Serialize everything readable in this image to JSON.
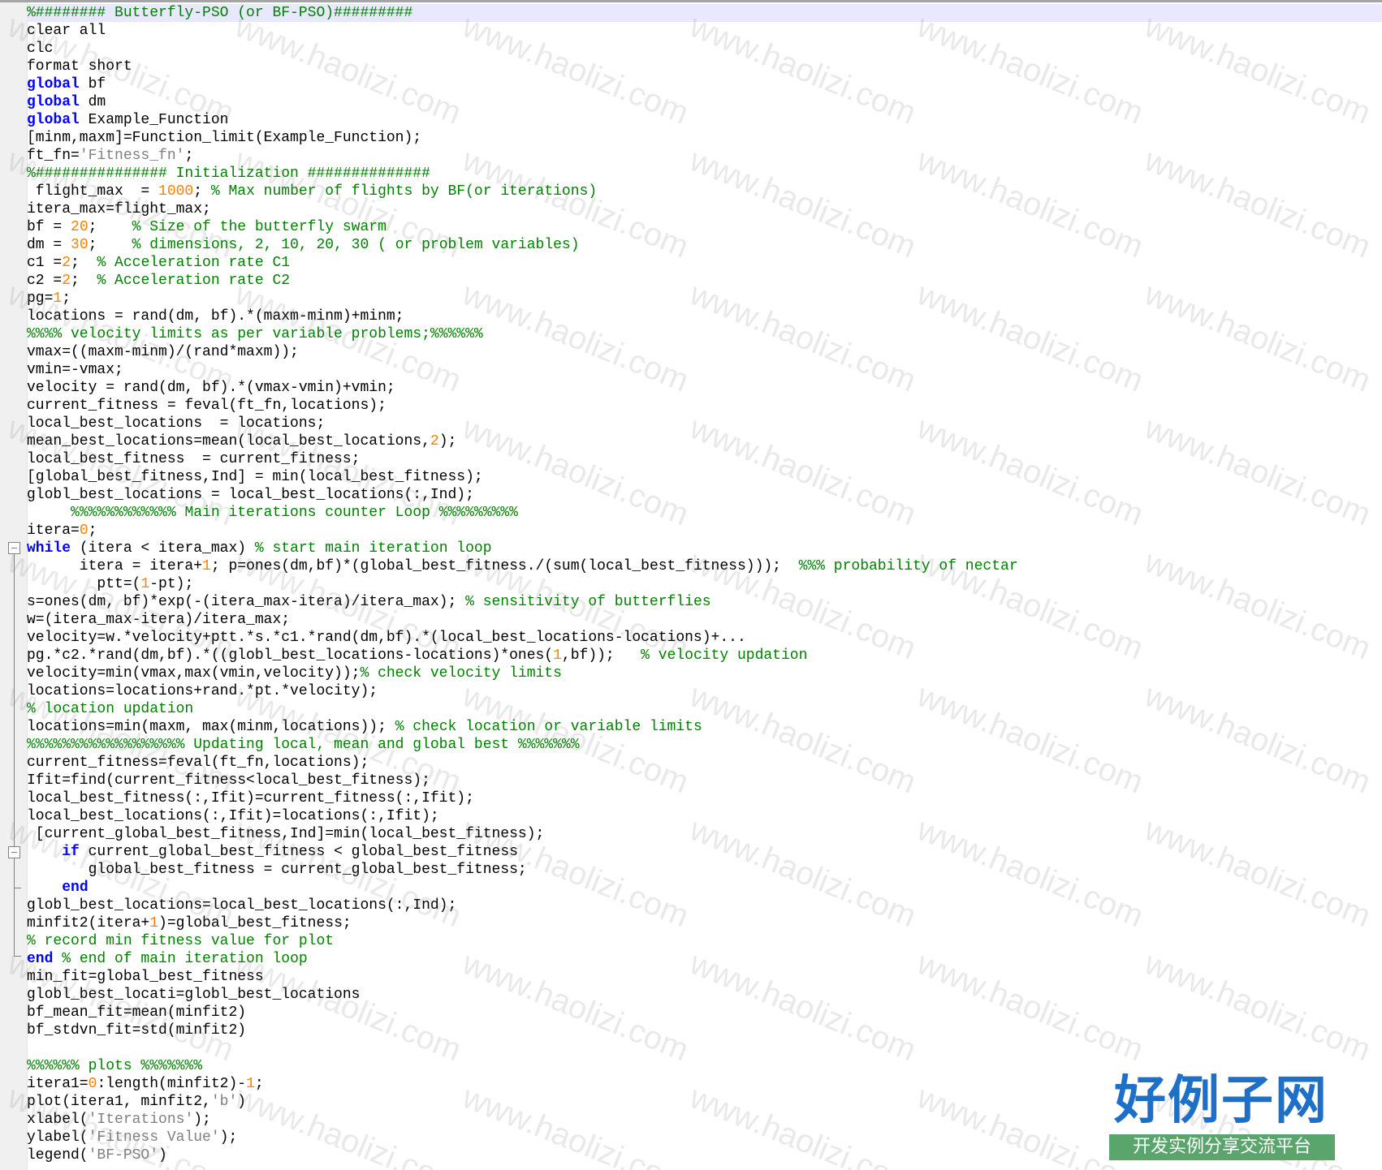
{
  "editor": {
    "language": "matlab",
    "colors": {
      "background": "#ffffff",
      "gutter": "#f0f0f0",
      "current_line": "#e8e8ff",
      "plain": "#000000",
      "keyword": "#0000ff",
      "comment": "#008000",
      "number": "#ff8000",
      "string": "#808080"
    },
    "lines": [
      [
        [
          "%######## Butterfly-PSO (or BF-PSO)#########",
          "comment"
        ]
      ],
      [
        [
          "clear all",
          "plain"
        ]
      ],
      [
        [
          "clc",
          "plain"
        ]
      ],
      [
        [
          "format short",
          "plain"
        ]
      ],
      [
        [
          "global",
          "keyword"
        ],
        [
          " bf",
          "plain"
        ]
      ],
      [
        [
          "global",
          "keyword"
        ],
        [
          " dm",
          "plain"
        ]
      ],
      [
        [
          "global",
          "keyword"
        ],
        [
          " Example_Function",
          "plain"
        ]
      ],
      [
        [
          "[minm,maxm]=Function_limit(Example_Function);",
          "plain"
        ]
      ],
      [
        [
          "ft_fn=",
          "plain"
        ],
        [
          "'Fitness_fn'",
          "string"
        ],
        [
          ";",
          "plain"
        ]
      ],
      [
        [
          "%############### Initialization ##############",
          "comment"
        ]
      ],
      [
        [
          " flight_max  = ",
          "plain"
        ],
        [
          "1000",
          "number"
        ],
        [
          "; ",
          "plain"
        ],
        [
          "% Max number of flights by BF(or iterations)",
          "comment"
        ]
      ],
      [
        [
          "itera_max=flight_max;",
          "plain"
        ]
      ],
      [
        [
          "bf = ",
          "plain"
        ],
        [
          "20",
          "number"
        ],
        [
          ";    ",
          "plain"
        ],
        [
          "% Size of the butterfly swarm",
          "comment"
        ]
      ],
      [
        [
          "dm = ",
          "plain"
        ],
        [
          "30",
          "number"
        ],
        [
          ";    ",
          "plain"
        ],
        [
          "% dimensions, 2, 10, 20, 30 ( or problem variables)",
          "comment"
        ]
      ],
      [
        [
          "c1 =",
          "plain"
        ],
        [
          "2",
          "number"
        ],
        [
          ";  ",
          "plain"
        ],
        [
          "% Acceleration rate C1",
          "comment"
        ]
      ],
      [
        [
          "c2 =",
          "plain"
        ],
        [
          "2",
          "number"
        ],
        [
          ";  ",
          "plain"
        ],
        [
          "% Acceleration rate C2",
          "comment"
        ]
      ],
      [
        [
          "pg=",
          "plain"
        ],
        [
          "1",
          "number"
        ],
        [
          ";",
          "plain"
        ]
      ],
      [
        [
          "locations = rand(dm, bf).*(maxm-minm)+minm;",
          "plain"
        ]
      ],
      [
        [
          "%%%% velocity limits as per variable problems;%%%%%%",
          "comment"
        ]
      ],
      [
        [
          "vmax=((maxm-minm)/(rand*maxm));",
          "plain"
        ]
      ],
      [
        [
          "vmin=-vmax;",
          "plain"
        ]
      ],
      [
        [
          "velocity = rand(dm, bf).*(vmax-vmin)+vmin;",
          "plain"
        ]
      ],
      [
        [
          "current_fitness = feval(ft_fn,locations);",
          "plain"
        ]
      ],
      [
        [
          "local_best_locations  = locations;",
          "plain"
        ]
      ],
      [
        [
          "mean_best_locations=mean(local_best_locations,",
          "plain"
        ],
        [
          "2",
          "number"
        ],
        [
          ");",
          "plain"
        ]
      ],
      [
        [
          "local_best_fitness  = current_fitness;",
          "plain"
        ]
      ],
      [
        [
          "[global_best_fitness,Ind] = min(local_best_fitness);",
          "plain"
        ]
      ],
      [
        [
          "globl_best_locations = local_best_locations(:,Ind);",
          "plain"
        ]
      ],
      [
        [
          "     ",
          "plain"
        ],
        [
          "%%%%%%%%%%%% Main iterations counter Loop %%%%%%%%%",
          "comment"
        ]
      ],
      [
        [
          "itera=",
          "plain"
        ],
        [
          "0",
          "number"
        ],
        [
          ";",
          "plain"
        ]
      ],
      [
        [
          "while",
          "keyword"
        ],
        [
          " (itera < itera_max) ",
          "plain"
        ],
        [
          "% start main iteration loop",
          "comment"
        ]
      ],
      [
        [
          "      itera = itera+",
          "plain"
        ],
        [
          "1",
          "number"
        ],
        [
          "; p=ones(dm,bf)*(global_best_fitness./(sum(local_best_fitness)));  ",
          "plain"
        ],
        [
          "%%% probability of nectar",
          "comment"
        ]
      ],
      [
        [
          "        ptt=(",
          "plain"
        ],
        [
          "1",
          "number"
        ],
        [
          "-pt);",
          "plain"
        ]
      ],
      [
        [
          "s=ones(dm, bf)*exp(-(itera_max-itera)/itera_max); ",
          "plain"
        ],
        [
          "% sensitivity of butterflies",
          "comment"
        ]
      ],
      [
        [
          "w=(itera_max-itera)/itera_max;",
          "plain"
        ]
      ],
      [
        [
          "velocity=w.*velocity+ptt.*s.*c1.*rand(dm,bf).*(local_best_locations-locations)+...",
          "plain"
        ]
      ],
      [
        [
          "pg.*c2.*rand(dm,bf).*((globl_best_locations-locations)*ones(",
          "plain"
        ],
        [
          "1",
          "number"
        ],
        [
          ",bf));   ",
          "plain"
        ],
        [
          "% velocity updation",
          "comment"
        ]
      ],
      [
        [
          "velocity=min(vmax,max(vmin,velocity));",
          "plain"
        ],
        [
          "% check velocity limits",
          "comment"
        ]
      ],
      [
        [
          "locations=locations+rand.*pt.*velocity);",
          "plain"
        ]
      ],
      [
        [
          "% location updation",
          "comment"
        ]
      ],
      [
        [
          "locations=min(maxm, max(minm,locations)); ",
          "plain"
        ],
        [
          "% check location or variable limits",
          "comment"
        ]
      ],
      [
        [
          "%%%%%%%%%%%%%%%%%% Updating local, mean and global best %%%%%%%",
          "comment"
        ]
      ],
      [
        [
          "current_fitness=feval(ft_fn,locations);",
          "plain"
        ]
      ],
      [
        [
          "Ifit=find(current_fitness<local_best_fitness);",
          "plain"
        ]
      ],
      [
        [
          "local_best_fitness(:,Ifit)=current_fitness(:,Ifit);",
          "plain"
        ]
      ],
      [
        [
          "local_best_locations(:,Ifit)=locations(:,Ifit);",
          "plain"
        ]
      ],
      [
        [
          " [current_global_best_fitness,Ind]=min(local_best_fitness);",
          "plain"
        ]
      ],
      [
        [
          "    ",
          "plain"
        ],
        [
          "if",
          "keyword"
        ],
        [
          " current_global_best_fitness < global_best_fitness",
          "plain"
        ]
      ],
      [
        [
          "       global_best_fitness = current_global_best_fitness;",
          "plain"
        ]
      ],
      [
        [
          "    ",
          "plain"
        ],
        [
          "end",
          "keyword"
        ]
      ],
      [
        [
          "globl_best_locations=local_best_locations(:,Ind);",
          "plain"
        ]
      ],
      [
        [
          "minfit2(itera+",
          "plain"
        ],
        [
          "1",
          "number"
        ],
        [
          ")=global_best_fitness;",
          "plain"
        ]
      ],
      [
        [
          "% record min fitness value for plot",
          "comment"
        ]
      ],
      [
        [
          "end",
          "keyword"
        ],
        [
          " ",
          "plain"
        ],
        [
          "% end of main iteration loop",
          "comment"
        ]
      ],
      [
        [
          "min_fit=global_best_fitness",
          "plain"
        ]
      ],
      [
        [
          "globl_best_locati=globl_best_locations",
          "plain"
        ]
      ],
      [
        [
          "bf_mean_fit=mean(minfit2)",
          "plain"
        ]
      ],
      [
        [
          "bf_stdvn_fit=std(minfit2)",
          "plain"
        ]
      ],
      [
        [
          "",
          "plain"
        ]
      ],
      [
        [
          "%%%%%% plots %%%%%%%",
          "comment"
        ]
      ],
      [
        [
          "itera1=",
          "plain"
        ],
        [
          "0",
          "number"
        ],
        [
          ":length(minfit2)-",
          "plain"
        ],
        [
          "1",
          "number"
        ],
        [
          ";",
          "plain"
        ]
      ],
      [
        [
          "plot(itera1, minfit2,",
          "plain"
        ],
        [
          "'b'",
          "string"
        ],
        [
          ")",
          "plain"
        ]
      ],
      [
        [
          "xlabel(",
          "plain"
        ],
        [
          "'Iterations'",
          "string"
        ],
        [
          ");",
          "plain"
        ]
      ],
      [
        [
          "ylabel(",
          "plain"
        ],
        [
          "'Fitness Value'",
          "string"
        ],
        [
          ");",
          "plain"
        ]
      ],
      [
        [
          "legend(",
          "plain"
        ],
        [
          "'BF-PSO'",
          "string"
        ],
        [
          ")",
          "plain"
        ]
      ]
    ]
  },
  "watermark": {
    "text": "www.haolizi.com",
    "logo_title": "好例子网",
    "logo_subtitle": "开发实例分享交流平台",
    "logo_color": "#1e6fc8",
    "banner_color": "#5aa56b"
  }
}
